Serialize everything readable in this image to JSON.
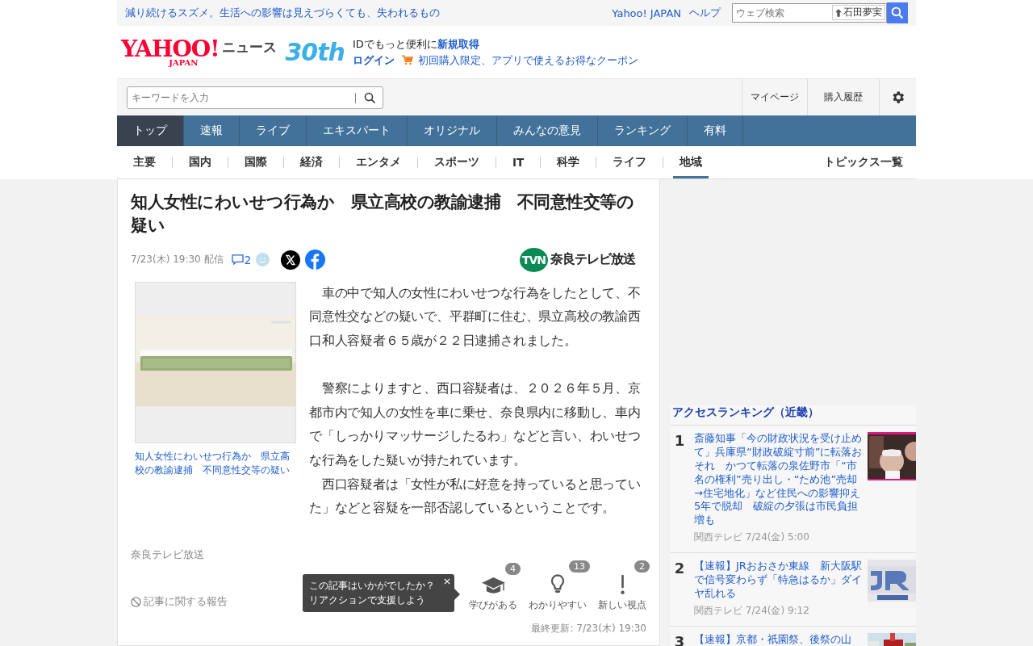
{
  "top_bar": {
    "headline": "減り続けるスズメ。生活への影響は見えづらくても、失われるもの",
    "links": [
      "Yahoo! JAPAN",
      "ヘルプ"
    ],
    "search": {
      "placeholder": "ウェブ検索",
      "chip": "石田夢実"
    }
  },
  "header": {
    "logo": {
      "main": "YAHOO!",
      "sub": "JAPAN",
      "service": "ニュース"
    },
    "anniversary": "30th",
    "promo": "IDでもっと便利に**新規取得**",
    "login": "ログイン",
    "coupon": "初回購入限定、アプリで使えるお得なクーポン"
  },
  "search_row": {
    "placeholder": "キーワードを入力",
    "links": [
      "マイページ",
      "購入履歴"
    ]
  },
  "main_nav": [
    {
      "label": "トップ",
      "selected": true
    },
    {
      "label": "速報",
      "selected": false
    },
    {
      "label": "ライブ",
      "selected": false
    },
    {
      "label": "エキスパート",
      "selected": false
    },
    {
      "label": "オリジナル",
      "selected": false
    },
    {
      "label": "みんなの意見",
      "selected": false
    },
    {
      "label": "ランキング",
      "selected": false
    },
    {
      "label": "有料",
      "selected": false
    }
  ],
  "sub_nav": {
    "items": [
      {
        "label": "主要",
        "selected": false
      },
      {
        "label": "国内",
        "selected": false
      },
      {
        "label": "国際",
        "selected": false
      },
      {
        "label": "経済",
        "selected": false
      },
      {
        "label": "エンタメ",
        "selected": false
      },
      {
        "label": "スポーツ",
        "selected": false
      },
      {
        "label": "IT",
        "selected": false
      },
      {
        "label": "科学",
        "selected": false
      },
      {
        "label": "ライフ",
        "selected": false
      },
      {
        "label": "地域",
        "selected": true
      }
    ],
    "topics": "トピックス一覧"
  },
  "article": {
    "title": "知人女性にわいせつ行為か　県立高校の教諭逮捕　不同意性交等の疑い",
    "date": "7/23(木) 19:30 配信",
    "comments": "2",
    "source_logo": {
      "mark": "TVN",
      "name": "奈良テレビ放送"
    },
    "figure": {
      "kind": "picture",
      "caption": "知人女性にわいせつ行為か　県立高校の教諭逮捕　不同意性交等の疑い"
    },
    "paragraph_groups": [
      [
        "　車の中で知人の女性にわいせつな行為をしたとして、不同意性交などの疑いで、平群町に住む、県立高校の教諭西口和人容疑者６５歳が２２日逮捕されました。"
      ],
      [
        "　警察によりますと、西口容疑者は、２０２６年５月、京都市内で知人の女性を車に乗せ、奈良県内に移動し、車内で「しっかりマッサージしたるわ」などと言い、わいせつな行為をした疑いが持たれています。",
        "　西口容疑者は「女性が私に好意を持っていると思っていた」などと容疑を一部否認しているということです。"
      ]
    ],
    "source": "奈良テレビ放送",
    "report": "記事に関する報告",
    "tooltip": [
      "この記事はいかがでしたか？",
      "リアクションで支援しよう"
    ],
    "reactions": [
      {
        "kind": "learn",
        "label": "学びがある",
        "count": "4"
      },
      {
        "kind": "clear",
        "label": "わかりやすい",
        "count": "13"
      },
      {
        "kind": "new",
        "label": "新しい視点",
        "count": "2"
      }
    ],
    "updated": "最終更新: 7/23(木) 19:30"
  },
  "ranking": {
    "title": "アクセスランキング（近畿）",
    "items": [
      {
        "rank": "1",
        "title": "斎藤知事「今の財政状況を受け止めて」兵庫県“財政破綻寸前”に転落おそれ　かつて転落の泉佐野市「“市名の権利”売り出し・“ため池”売却→住宅地化」など住民への影響抑え5年で脱却　破綻の夕張は市民負担増も",
        "meta": "関西テレビ 7/24(金) 5:00"
      },
      {
        "rank": "2",
        "title": "【速報】JRおおさか東線　新大阪駅で信号変わらず「特急はるか」ダイヤ乱れる",
        "meta": "関西テレビ 7/24(金) 9:12"
      },
      {
        "rank": "3",
        "title": "【速報】京都・祇園祭、後祭の山"
      }
    ]
  }
}
